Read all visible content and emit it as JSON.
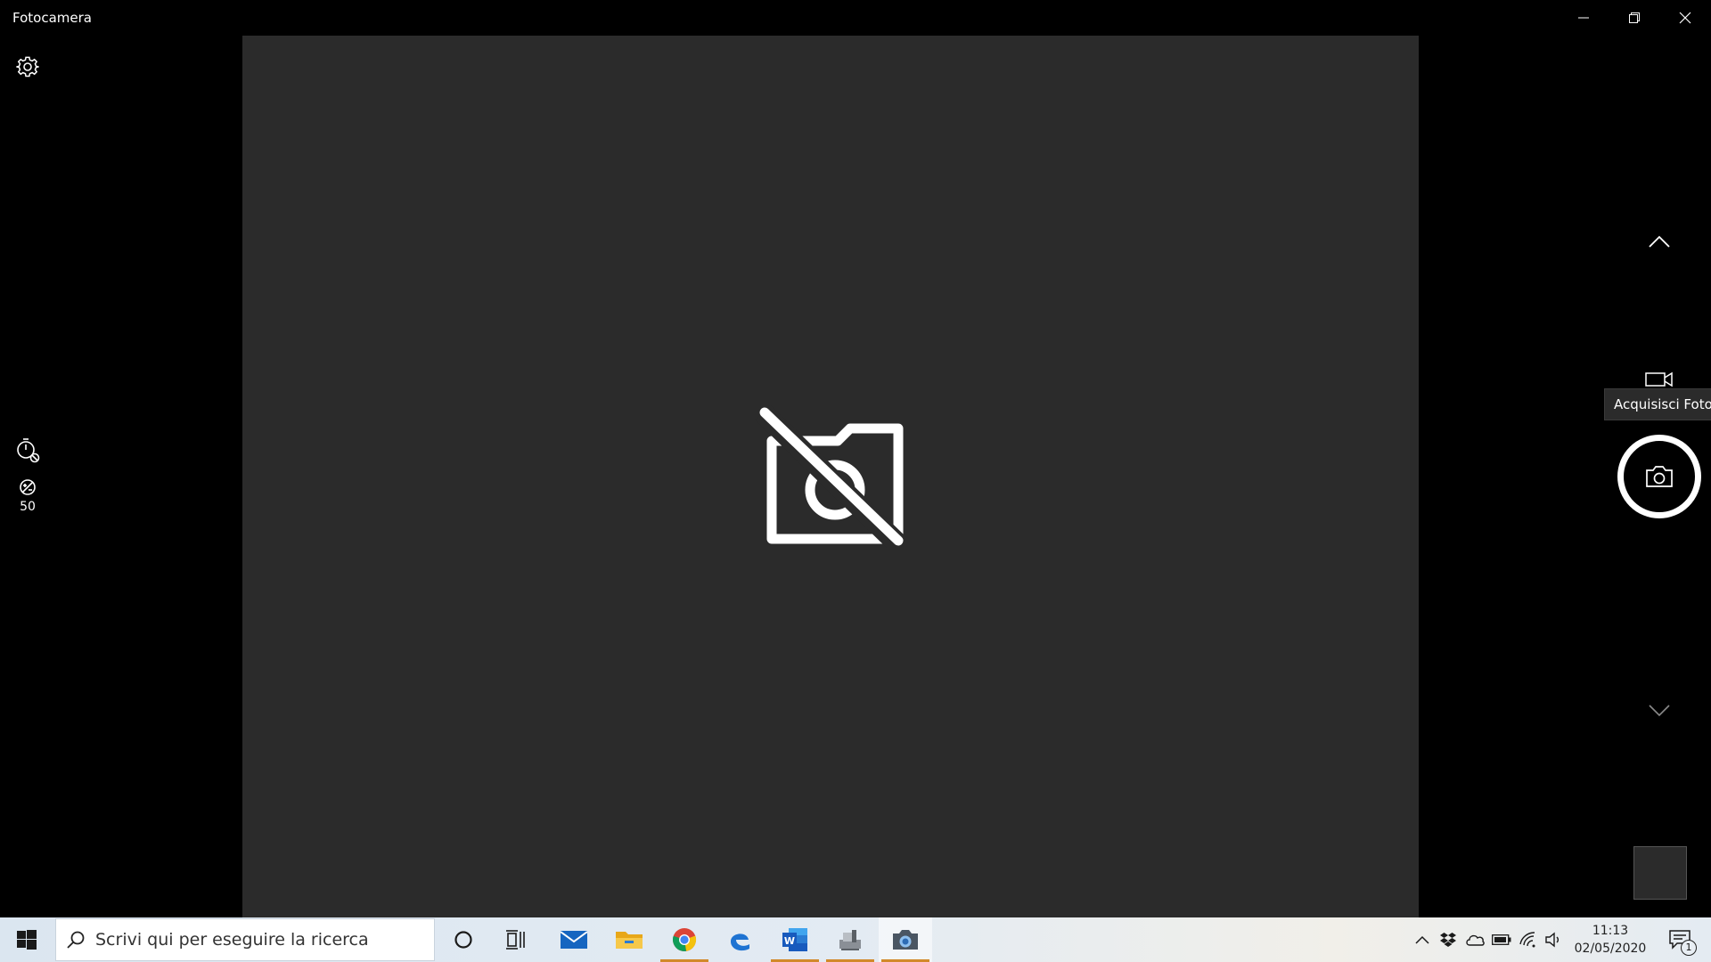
{
  "window": {
    "title": "Fotocamera"
  },
  "left_panel": {
    "brightness_value": "50",
    "icons": [
      "gear-icon",
      "timer-off-icon",
      "brightness-icon"
    ]
  },
  "right_panel": {
    "tooltip": "Acquisisci Foto",
    "icons": [
      "chevron-up-icon",
      "video-camera-icon",
      "camera-icon",
      "chevron-down-icon"
    ]
  },
  "viewfinder": {
    "status_icon": "camera-off-icon"
  },
  "taskbar": {
    "search_placeholder": "Scrivi qui per eseguire la ricerca",
    "apps": [
      "mail-icon",
      "file-explorer-icon",
      "chrome-icon",
      "edge-icon",
      "word-icon",
      "app-icon",
      "camera-icon"
    ],
    "clock_time": "11:13",
    "clock_date": "02/05/2020",
    "notification_count": "1",
    "accent_running": "#d2892a"
  }
}
